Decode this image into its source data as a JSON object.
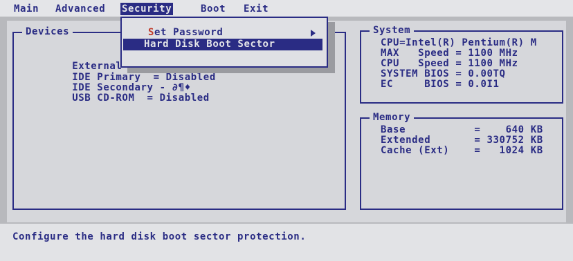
{
  "menubar": {
    "items": [
      "Main",
      "Advanced",
      "Security",
      "Boot",
      "Exit"
    ],
    "active": "Security"
  },
  "security_menu": {
    "set_password": {
      "hotkey": "S",
      "rest": "et Password"
    },
    "hard_disk_boot_sector": {
      "label": "Hard Disk Boot Sector"
    }
  },
  "devices": {
    "title": "Devices",
    "rows": [
      {
        "label": "External Flo",
        "value": ""
      },
      {
        "label": "IDE Primary  ",
        "value": "= Disabled"
      },
      {
        "label": "IDE Secondary ",
        "value": "- ∂¶♦"
      },
      {
        "label": "USB CD-ROM  ",
        "value": "= Disabled"
      }
    ]
  },
  "system": {
    "title": "System",
    "lines": [
      "CPU=Intel(R) Pentium(R) M",
      "MAX   Speed = 1100 MHz",
      "CPU   Speed = 1100 MHz",
      "SYSTEM BIOS = 0.00TQ",
      "EC     BIOS = 0.0I1"
    ]
  },
  "memory": {
    "title": "Memory",
    "lines": [
      "Base           =    640 KB",
      "Extended       = 330752 KB",
      "Cache (Ext)    =   1024 KB"
    ]
  },
  "status": {
    "text": "Configure the hard disk boot sector protection."
  },
  "colors": {
    "text": "#2a2c84",
    "background": "#d6d7db",
    "highlight": "#2a2c84",
    "hotkey": "#c03a2a"
  }
}
